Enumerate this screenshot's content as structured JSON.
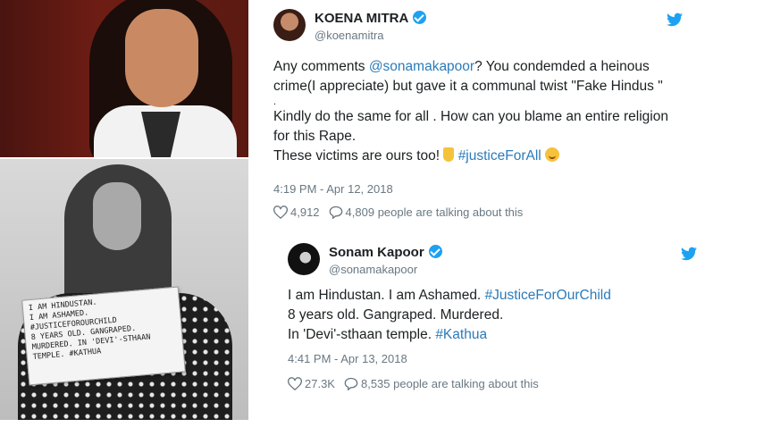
{
  "placard": {
    "lines": [
      "I am Hindustan.",
      "I am Ashamed.",
      "#JusticeForOurChild",
      "8 years old. Gangraped.",
      "Murdered. In 'Devi'-sthaan",
      "temple. #Kathua"
    ]
  },
  "tweet1": {
    "name": "KOENA MITRA",
    "handle": "@koenamitra",
    "line1_pre": "Any comments ",
    "line1_mention": "@sonamakapoor",
    "line1_post": "?  You condemded a heinous",
    "line2": "crime(I appreciate) but gave it a communal twist \"Fake Hindus \"",
    "line3": ".",
    "line4": "Kindly do the same for all . How can you blame an entire religion",
    "line5": "for this Rape.",
    "line6_pre": "These victims are ours too! ",
    "line6_hashtag": "#justiceForAll",
    "time": "4:19 PM - Apr 12, 2018",
    "likes": "4,912",
    "talking": "4,809 people are talking about this"
  },
  "tweet2": {
    "name": "Sonam Kapoor",
    "handle": "@sonamakapoor",
    "line1_pre": "I am Hindustan. I am Ashamed. ",
    "line1_hashtag": "#JusticeForOurChild",
    "line2": "8 years old. Gangraped. Murdered.",
    "line3_pre": "In 'Devi'-sthaan temple. ",
    "line3_hashtag": "#Kathua",
    "time": "4:41 PM - Apr 13, 2018",
    "likes": "27.3K",
    "talking": "8,535 people are talking about this"
  },
  "icons": [
    "twitter-bird-icon",
    "verified-badge-icon",
    "heart-icon",
    "comment-icon",
    "point-down-emoji",
    "smile-emoji"
  ],
  "colors": {
    "link": "#2b7bb9",
    "muted": "#697882",
    "verified": "#1da1f2",
    "text": "#1c2022"
  }
}
